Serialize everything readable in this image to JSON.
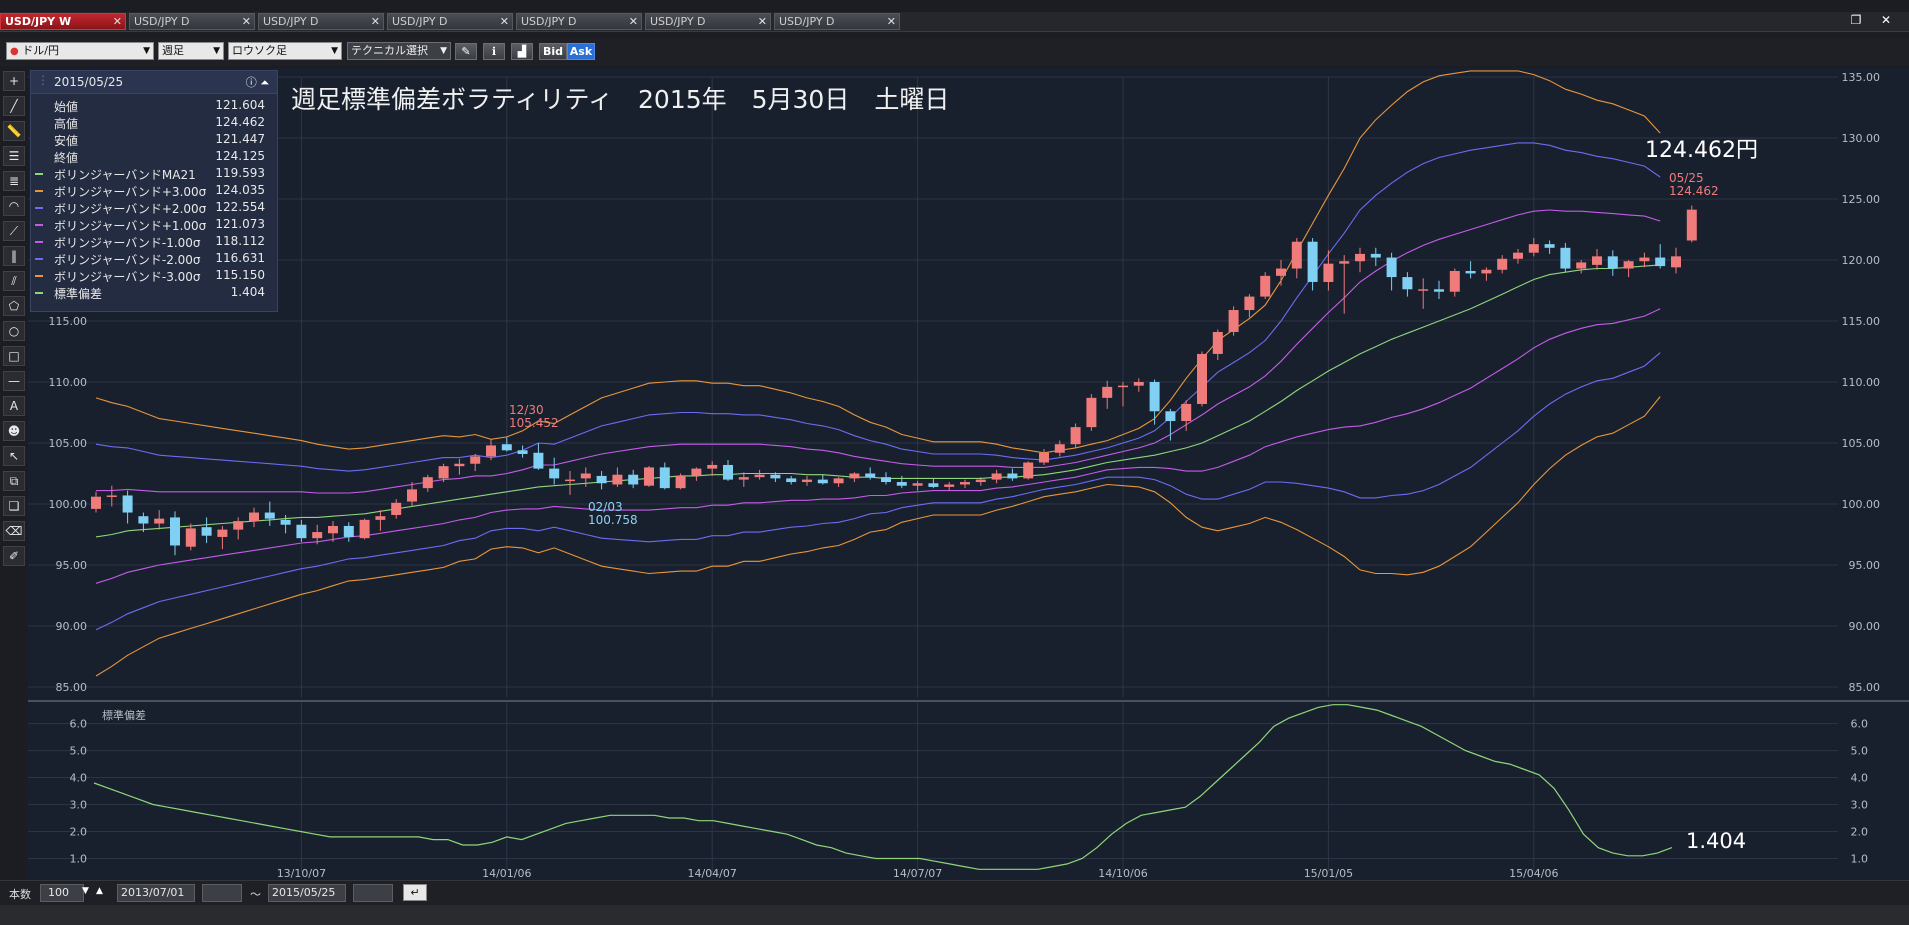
{
  "tabs": [
    {
      "label": "USD/JPY W",
      "active": true
    },
    {
      "label": "USD/JPY D",
      "active": false
    },
    {
      "label": "USD/JPY D",
      "active": false
    },
    {
      "label": "USD/JPY D",
      "active": false
    },
    {
      "label": "USD/JPY D",
      "active": false
    },
    {
      "label": "USD/JPY D",
      "active": false
    },
    {
      "label": "USD/JPY D",
      "active": false
    }
  ],
  "toolbar": {
    "pair": "ドル/円",
    "period": "週足",
    "chart_style": "ロウソク足",
    "technical": "テクニカル選択",
    "bid": "Bid",
    "ask": "Ask"
  },
  "info_panel": {
    "date": "2015/05/25",
    "rows": [
      {
        "label": "始値",
        "value": "121.604",
        "color": ""
      },
      {
        "label": "高値",
        "value": "124.462",
        "color": ""
      },
      {
        "label": "安値",
        "value": "121.447",
        "color": ""
      },
      {
        "label": "終値",
        "value": "124.125",
        "color": ""
      },
      {
        "label": "ボリンジャーバンドMA21",
        "value": "119.593",
        "color": "#8fd67a"
      },
      {
        "label": "ボリンジャーバンド+3.00σ",
        "value": "124.035",
        "color": "#e8963a"
      },
      {
        "label": "ボリンジャーバンド+2.00σ",
        "value": "122.554",
        "color": "#6b6cf2"
      },
      {
        "label": "ボリンジャーバンド+1.00σ",
        "value": "121.073",
        "color": "#c45ce8"
      },
      {
        "label": "ボリンジャーバンド-1.00σ",
        "value": "118.112",
        "color": "#c45ce8"
      },
      {
        "label": "ボリンジャーバンド-2.00σ",
        "value": "116.631",
        "color": "#6b6cf2"
      },
      {
        "label": "ボリンジャーバンド-3.00σ",
        "value": "115.150",
        "color": "#e8963a"
      },
      {
        "label": "標準偏差",
        "value": "1.404",
        "color": "#8fd67a"
      }
    ]
  },
  "chart_title": "週足標準偏差ボラティリティ　2015年　5月30日　土曜日",
  "last_price": "124.462円",
  "last_std": "1.404",
  "annotations": {
    "high_date": "12/30",
    "high_value": "105.452",
    "low_date": "02/03",
    "low_value": "100.758",
    "last_date": "05/25",
    "last_value": "124.462"
  },
  "sub_label": "標準偏差",
  "bottom": {
    "count_label": "本数",
    "count_value": "100",
    "from_date": "2013/07/01",
    "tilde": "〜",
    "to_date": "2015/05/25"
  },
  "colors": {
    "up": "#f07b7b",
    "down": "#7fd0f2",
    "ma": "#8fd67a",
    "band3": "#e8963a",
    "band2": "#6b6cf2",
    "band1": "#c45ce8",
    "std": "#8fd67a"
  },
  "chart_data": [
    {
      "type": "candlestick",
      "title": "週足標準偏差ボラティリティ　2015年　5月30日　土曜日",
      "ylim": [
        85,
        135
      ],
      "y_ticks": [
        "135.00",
        "130.00",
        "125.00",
        "120.00",
        "115.00",
        "110.00",
        "105.00",
        "100.00",
        "95.00",
        "90.00",
        "85.00"
      ],
      "x_tick_labels": [
        "13/10/07",
        "14/01/06",
        "14/04/07",
        "14/07/07",
        "14/10/06",
        "15/01/05",
        "15/04/06"
      ],
      "x_tick_index": [
        13,
        26,
        39,
        52,
        65,
        78,
        91
      ],
      "grid": true,
      "ohlc": [
        [
          99.6,
          101.0,
          99.3,
          100.6
        ],
        [
          100.6,
          101.5,
          99.8,
          100.7
        ],
        [
          100.7,
          101.1,
          98.4,
          99.3
        ],
        [
          99.0,
          99.3,
          97.7,
          98.4
        ],
        [
          98.4,
          99.5,
          97.9,
          98.8
        ],
        [
          98.9,
          99.4,
          95.8,
          96.6
        ],
        [
          96.5,
          98.4,
          96.2,
          98.0
        ],
        [
          98.1,
          98.9,
          96.8,
          97.4
        ],
        [
          97.3,
          98.2,
          96.3,
          97.9
        ],
        [
          97.9,
          98.9,
          97.1,
          98.6
        ],
        [
          98.6,
          99.7,
          98.1,
          99.3
        ],
        [
          99.3,
          100.2,
          98.2,
          98.8
        ],
        [
          98.7,
          99.1,
          97.6,
          98.3
        ],
        [
          98.3,
          98.7,
          96.9,
          97.2
        ],
        [
          97.2,
          98.3,
          96.7,
          97.7
        ],
        [
          97.6,
          98.6,
          96.9,
          98.2
        ],
        [
          98.2,
          98.5,
          96.9,
          97.3
        ],
        [
          97.2,
          98.8,
          97.1,
          98.7
        ],
        [
          98.7,
          99.5,
          97.8,
          99.0
        ],
        [
          99.1,
          100.4,
          98.8,
          100.1
        ],
        [
          100.2,
          101.8,
          99.8,
          101.2
        ],
        [
          101.3,
          102.4,
          101.0,
          102.2
        ],
        [
          102.1,
          103.3,
          101.8,
          103.1
        ],
        [
          103.1,
          103.7,
          102.4,
          103.3
        ],
        [
          103.3,
          104.1,
          102.7,
          103.9
        ],
        [
          103.9,
          105.3,
          103.6,
          104.8
        ],
        [
          104.9,
          105.45,
          104.3,
          104.4
        ],
        [
          104.4,
          104.8,
          103.8,
          104.1
        ],
        [
          104.2,
          105.0,
          102.8,
          102.9
        ],
        [
          102.9,
          103.8,
          101.6,
          102.1
        ],
        [
          102.0,
          102.7,
          100.76,
          102.0
        ],
        [
          102.1,
          103.0,
          101.4,
          102.5
        ],
        [
          102.3,
          102.7,
          101.2,
          101.7
        ],
        [
          101.6,
          103.0,
          101.4,
          102.4
        ],
        [
          102.4,
          102.8,
          101.3,
          101.6
        ],
        [
          101.5,
          103.1,
          101.4,
          103.0
        ],
        [
          103.0,
          103.4,
          101.2,
          101.3
        ],
        [
          101.3,
          102.5,
          101.2,
          102.3
        ],
        [
          102.3,
          103.0,
          101.9,
          102.9
        ],
        [
          102.9,
          103.5,
          102.3,
          103.2
        ],
        [
          103.2,
          103.6,
          101.9,
          102.0
        ],
        [
          102.0,
          102.6,
          101.4,
          102.2
        ],
        [
          102.2,
          102.8,
          102.0,
          102.4
        ],
        [
          102.4,
          102.6,
          101.8,
          102.1
        ],
        [
          102.1,
          102.3,
          101.6,
          101.8
        ],
        [
          101.8,
          102.3,
          101.5,
          102.0
        ],
        [
          102.0,
          102.4,
          101.6,
          101.7
        ],
        [
          101.7,
          102.2,
          101.4,
          102.1
        ],
        [
          102.1,
          102.6,
          101.8,
          102.5
        ],
        [
          102.5,
          103.0,
          102.0,
          102.2
        ],
        [
          102.2,
          102.6,
          101.6,
          101.8
        ],
        [
          101.8,
          102.3,
          101.3,
          101.5
        ],
        [
          101.5,
          101.9,
          101.1,
          101.7
        ],
        [
          101.7,
          102.1,
          101.3,
          101.4
        ],
        [
          101.4,
          101.8,
          101.1,
          101.6
        ],
        [
          101.6,
          102.0,
          101.3,
          101.8
        ],
        [
          101.8,
          102.2,
          101.5,
          102.0
        ],
        [
          102.0,
          102.8,
          101.7,
          102.5
        ],
        [
          102.5,
          102.9,
          101.9,
          102.1
        ],
        [
          102.1,
          103.5,
          102.0,
          103.4
        ],
        [
          103.4,
          104.5,
          103.2,
          104.2
        ],
        [
          104.2,
          105.2,
          103.9,
          104.9
        ],
        [
          104.9,
          106.6,
          104.6,
          106.3
        ],
        [
          106.3,
          109.0,
          106.0,
          108.7
        ],
        [
          108.7,
          110.1,
          107.8,
          109.6
        ],
        [
          109.6,
          110.0,
          108.0,
          109.7
        ],
        [
          109.7,
          110.3,
          109.2,
          110.0
        ],
        [
          110.0,
          110.2,
          106.5,
          107.6
        ],
        [
          107.6,
          107.8,
          105.2,
          106.8
        ],
        [
          106.8,
          108.5,
          106.0,
          108.2
        ],
        [
          108.2,
          112.5,
          108.0,
          112.3
        ],
        [
          112.3,
          114.3,
          111.8,
          114.1
        ],
        [
          114.1,
          116.2,
          113.8,
          115.9
        ],
        [
          115.9,
          117.2,
          115.3,
          117.0
        ],
        [
          117.0,
          119.0,
          116.8,
          118.7
        ],
        [
          118.7,
          120.0,
          117.9,
          119.3
        ],
        [
          119.3,
          121.8,
          118.5,
          121.5
        ],
        [
          121.5,
          121.8,
          117.5,
          118.2
        ],
        [
          118.2,
          120.8,
          117.5,
          119.7
        ],
        [
          119.7,
          120.4,
          115.6,
          119.9
        ],
        [
          119.9,
          121.0,
          119.0,
          120.5
        ],
        [
          120.5,
          121.0,
          119.5,
          120.2
        ],
        [
          120.2,
          120.6,
          117.5,
          118.6
        ],
        [
          118.6,
          119.0,
          117.0,
          117.6
        ],
        [
          117.6,
          118.5,
          116.0,
          117.6
        ],
        [
          117.6,
          118.3,
          116.8,
          117.4
        ],
        [
          117.4,
          119.3,
          117.0,
          119.1
        ],
        [
          119.1,
          119.9,
          118.5,
          118.9
        ],
        [
          118.9,
          119.4,
          118.3,
          119.2
        ],
        [
          119.2,
          120.4,
          118.9,
          120.1
        ],
        [
          120.1,
          120.9,
          119.7,
          120.6
        ],
        [
          120.6,
          121.8,
          120.3,
          121.3
        ],
        [
          121.3,
          121.6,
          120.5,
          121.0
        ],
        [
          121.0,
          121.4,
          119.0,
          119.3
        ],
        [
          119.3,
          120.0,
          118.9,
          119.8
        ],
        [
          119.6,
          120.9,
          119.2,
          120.3
        ],
        [
          120.3,
          120.8,
          118.7,
          119.3
        ],
        [
          119.3,
          120.0,
          118.6,
          119.9
        ],
        [
          119.9,
          120.6,
          119.4,
          120.2
        ],
        [
          120.2,
          121.3,
          119.3,
          119.5
        ],
        [
          119.4,
          121.0,
          118.9,
          120.3
        ],
        [
          121.6,
          124.462,
          121.447,
          124.125
        ]
      ],
      "ma21": [
        97.3,
        97.5,
        97.8,
        97.9,
        98.0,
        98.1,
        98.2,
        98.3,
        98.4,
        98.5,
        98.6,
        98.7,
        98.8,
        98.9,
        98.9,
        99.0,
        99.1,
        99.2,
        99.4,
        99.6,
        99.8,
        100.0,
        100.2,
        100.4,
        100.6,
        100.8,
        101.0,
        101.2,
        101.4,
        101.5,
        101.6,
        101.7,
        101.8,
        101.9,
        102.0,
        102.1,
        102.2,
        102.3,
        102.3,
        102.4,
        102.4,
        102.5,
        102.5,
        102.5,
        102.5,
        102.4,
        102.4,
        102.3,
        102.2,
        102.2,
        102.1,
        102.1,
        102.1,
        102.1,
        102.1,
        102.1,
        102.1,
        102.2,
        102.2,
        102.3,
        102.4,
        102.6,
        102.8,
        103.1,
        103.4,
        103.6,
        103.8,
        104.0,
        104.3,
        104.6,
        105.0,
        105.6,
        106.2,
        106.8,
        107.6,
        108.4,
        109.3,
        110.1,
        110.9,
        111.6,
        112.3,
        112.9,
        113.5,
        114.0,
        114.5,
        115.0,
        115.5,
        116.0,
        116.6,
        117.2,
        117.8,
        118.4,
        118.8,
        119.0,
        119.2,
        119.3,
        119.3,
        119.4,
        119.5,
        119.6
      ]
    },
    {
      "type": "line",
      "title": "標準偏差",
      "ylim": [
        0.5,
        6.8
      ],
      "y_ticks": [
        "6.0",
        "5.0",
        "4.0",
        "3.0",
        "2.0",
        "1.0"
      ],
      "series": [
        {
          "name": "標準偏差",
          "values": [
            3.8,
            3.6,
            3.4,
            3.2,
            3.0,
            2.9,
            2.8,
            2.7,
            2.6,
            2.5,
            2.4,
            2.3,
            2.2,
            2.1,
            2.0,
            1.9,
            1.8,
            1.8,
            1.8,
            1.8,
            1.8,
            1.8,
            1.8,
            1.7,
            1.7,
            1.5,
            1.5,
            1.6,
            1.8,
            1.7,
            1.9,
            2.1,
            2.3,
            2.4,
            2.5,
            2.6,
            2.6,
            2.6,
            2.6,
            2.5,
            2.5,
            2.4,
            2.4,
            2.3,
            2.2,
            2.1,
            2.0,
            1.9,
            1.7,
            1.5,
            1.4,
            1.2,
            1.1,
            1.0,
            1.0,
            1.0,
            1.0,
            0.9,
            0.8,
            0.7,
            0.6,
            0.6,
            0.6,
            0.6,
            0.6,
            0.7,
            0.8,
            1.0,
            1.4,
            1.9,
            2.3,
            2.6,
            2.7,
            2.8,
            2.9,
            3.3,
            3.8,
            4.3,
            4.8,
            5.3,
            5.9,
            6.2,
            6.4,
            6.6,
            6.7,
            6.7,
            6.6,
            6.5,
            6.3,
            6.1,
            5.9,
            5.6,
            5.3,
            5.0,
            4.8,
            4.6,
            4.5,
            4.3,
            4.1,
            3.6,
            2.8,
            1.9,
            1.4,
            1.2,
            1.1,
            1.1,
            1.2,
            1.404
          ]
        }
      ]
    }
  ]
}
